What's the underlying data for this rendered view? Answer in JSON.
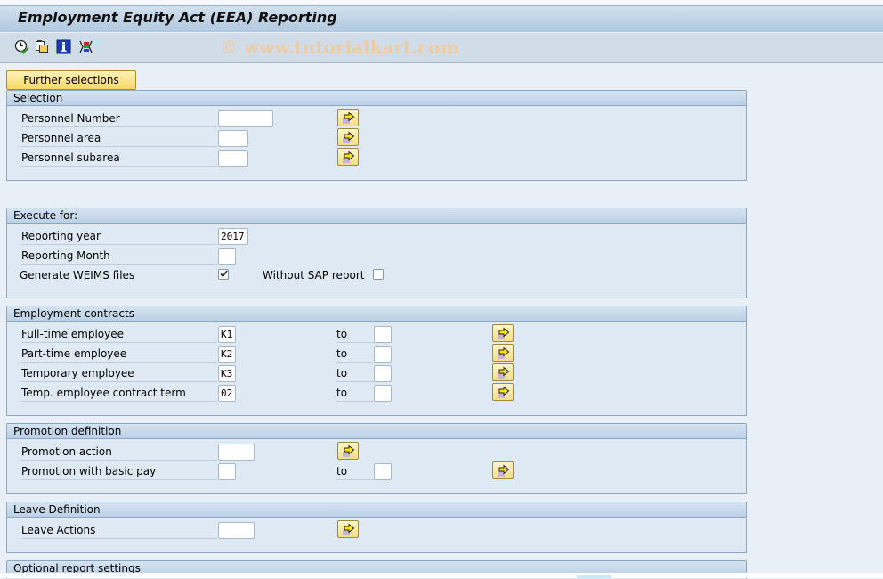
{
  "window": {
    "title": "Employment Equity Act (EEA) Reporting",
    "watermark": "© www.tutorialkart.com"
  },
  "toolbar": {
    "icons": [
      {
        "name": "execute-clock-icon"
      },
      {
        "name": "get-variant-icon"
      },
      {
        "name": "info-icon"
      },
      {
        "name": "selection-options-icon"
      }
    ]
  },
  "further_selections": "Further selections",
  "groups": {
    "selection": {
      "title": "Selection",
      "rows": [
        {
          "label": "Personnel Number",
          "value": ""
        },
        {
          "label": "Personnel area",
          "value": ""
        },
        {
          "label": "Personnel subarea",
          "value": ""
        }
      ]
    },
    "execute_for": {
      "title": "Execute for:",
      "reporting_year_label": "Reporting year",
      "reporting_year_value": "2017",
      "reporting_month_label": "Reporting Month",
      "reporting_month_value": "",
      "generate_weims_label": "Generate WEIMS files",
      "generate_weims_checked": true,
      "without_sap_label": "Without SAP report",
      "without_sap_checked": false
    },
    "employment_contracts": {
      "title": "Employment contracts",
      "to_label": "to",
      "rows": [
        {
          "label": "Full-time employee",
          "from": "K1",
          "to": ""
        },
        {
          "label": "Part-time employee",
          "from": "K2",
          "to": ""
        },
        {
          "label": "Temporary employee",
          "from": "K3",
          "to": ""
        },
        {
          "label": "Temp. employee contract term",
          "from": "02",
          "to": ""
        }
      ]
    },
    "promotion_definition": {
      "title": "Promotion definition",
      "to_label": "to",
      "promotion_action_label": "Promotion action",
      "promotion_action_value": "",
      "promotion_basic_pay_label": "Promotion with basic pay",
      "promotion_basic_pay_from": "",
      "promotion_basic_pay_to": ""
    },
    "leave_definition": {
      "title": "Leave Definition",
      "leave_actions_label": "Leave Actions",
      "leave_actions_value": ""
    },
    "optional_settings": {
      "title": "Optional report settings"
    }
  }
}
